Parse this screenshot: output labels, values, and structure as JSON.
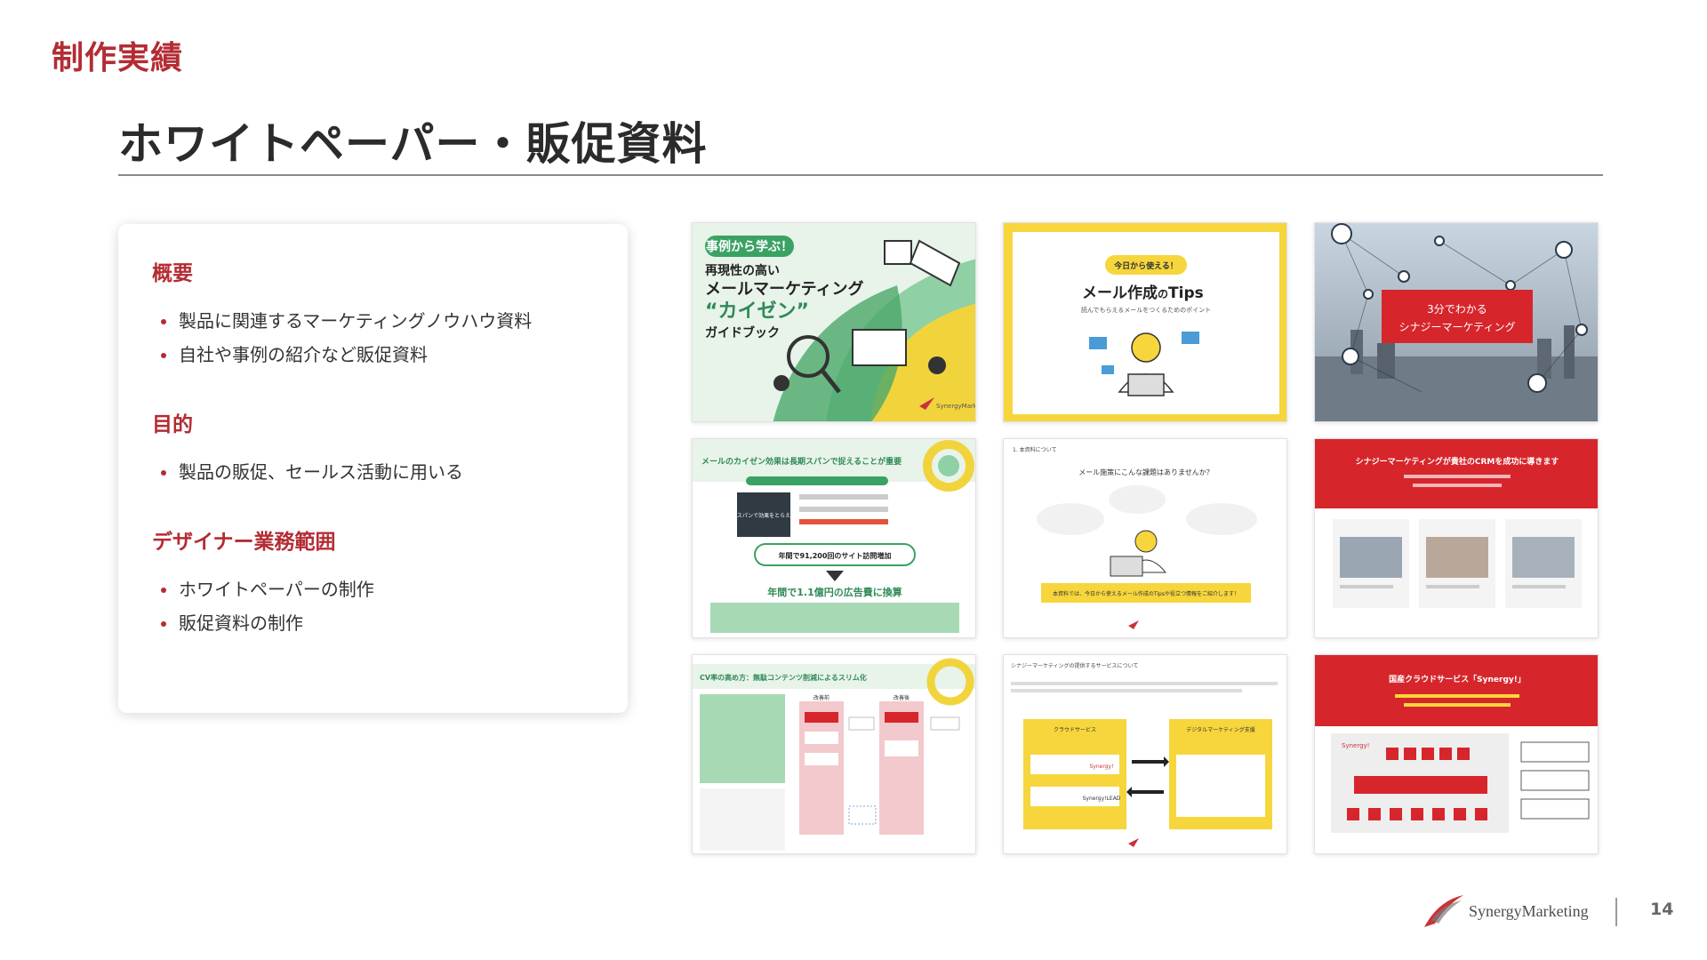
{
  "header": {
    "section_label": "制作実績",
    "page_title": "ホワイトペーパー・販促資料"
  },
  "card": {
    "sections": [
      {
        "heading": "概要",
        "items": [
          "製品に関連するマーケティングノウハウ資料",
          "自社や事例の紹介など販促資料"
        ]
      },
      {
        "heading": "目的",
        "items": [
          "製品の販促、セールス活動に用いる"
        ]
      },
      {
        "heading": "デザイナー業務範囲",
        "items": [
          "ホワイトペーパーの制作",
          "販促資料の制作"
        ]
      }
    ]
  },
  "thumbnails": {
    "t1": {
      "badge": "事例から学ぶ！",
      "line1": "再現性の高い",
      "line2": "メールマーケティング",
      "line3": "“カイゼン”",
      "line4": "ガイドブック",
      "logo": "SynergyMarketing"
    },
    "t2": {
      "badge": "今日から使える！",
      "title_a": "メール作成",
      "title_b": "の",
      "title_c": "Tips",
      "subtitle": "読んでもらえるメールをつくるためのポイント"
    },
    "t3": {
      "line1": "3分でわかる",
      "line2": "シナジーマーケティング"
    },
    "t4": {
      "title": "メールのカイゼン効果は長期スパンで捉えることが重要",
      "box": "長期スパンで効果をとらえた例",
      "result1": "年間で91,200回のサイト訪問増加",
      "result2": "年間で1.1億円の広告費に換算"
    },
    "t5": {
      "header": "1. 本資料について",
      "question": "メール施策にこんな課題はありませんか？",
      "banner": "本資料では、今日から使えるメール作成のTipsや役立つ情報をご紹介します！"
    },
    "t6": {
      "title": "シナジーマーケティングが貴社のCRMを成功に導きます"
    },
    "t7": {
      "title": "CV率の高め方：無駄コンテンツ削減によるスリム化",
      "before": "改善前",
      "after": "改善後"
    },
    "t8": {
      "header": "シナジーマーケティングの提供するサービスについて",
      "left": "クラウドサービス",
      "right": "デジタルマーケティング支援",
      "logo_a": "Synergy!",
      "logo_b": "Synergy!LEAD"
    },
    "t9": {
      "title": "国産クラウドサービス「Synergy!」",
      "logo": "Synergy!"
    }
  },
  "footer": {
    "logo_text": "SynergyMarketing",
    "page_number": "14"
  },
  "colors": {
    "brand_red": "#b32c34",
    "thumb_red": "#d6262c",
    "yellow": "#f5d33a",
    "green": "#a7d9b5",
    "pale_green": "#e8f3ea"
  }
}
